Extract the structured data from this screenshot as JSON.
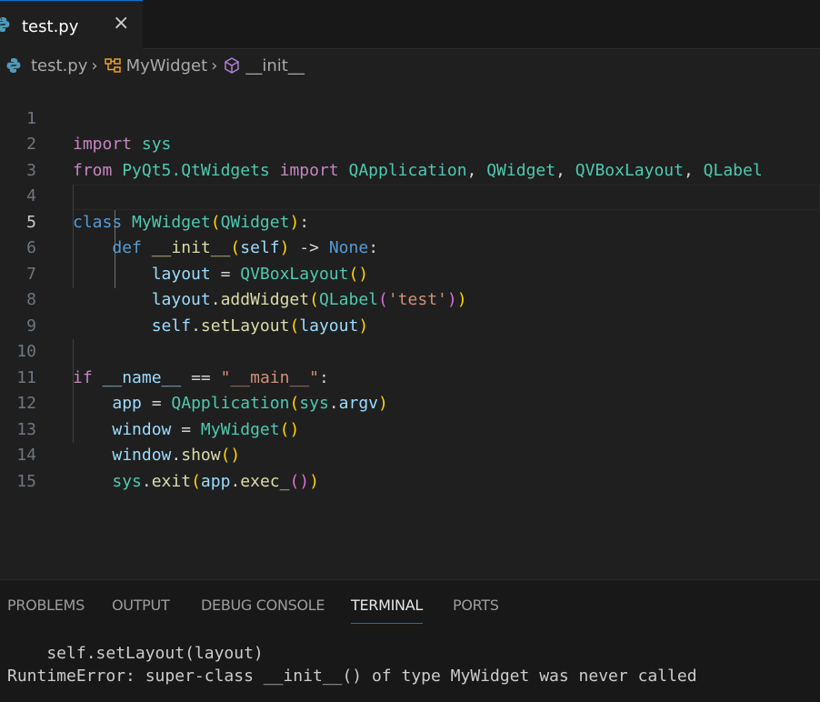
{
  "tab": {
    "label": "test.py",
    "close": "×"
  },
  "breadcrumb": {
    "file": "test.py",
    "class": "MyWidget",
    "method": "__init__",
    "sep": "›"
  },
  "lines": [
    "1",
    "2",
    "3",
    "4",
    "5",
    "6",
    "7",
    "8",
    "9",
    "10",
    "11",
    "12",
    "13",
    "14",
    "15"
  ],
  "code": {
    "l1": [
      "import",
      " ",
      "sys"
    ],
    "l2": [
      "from",
      " ",
      "PyQt5.QtWidgets",
      " ",
      "import",
      " ",
      "QApplication",
      ", ",
      "QWidget",
      ", ",
      "QVBoxLayout",
      ", ",
      "QLabel"
    ],
    "l4": [
      "class",
      " ",
      "MyWidget",
      "(",
      "QWidget",
      "):"
    ],
    "l5": [
      "    ",
      "def",
      " ",
      "__init__",
      "(",
      "self",
      ")",
      " -> ",
      "None",
      ":"
    ],
    "l6": [
      "        ",
      "layout",
      " = ",
      "QVBoxLayout",
      "()"
    ],
    "l7": [
      "        ",
      "layout",
      ".",
      "addWidget",
      "(",
      "QLabel",
      "(",
      "'test'",
      ")",
      ")"
    ],
    "l8": [
      "        ",
      "self",
      ".",
      "setLayout",
      "(",
      "layout",
      ")"
    ],
    "l10": [
      "if",
      " ",
      "__name__",
      " == ",
      "\"__main__\"",
      ":"
    ],
    "l11": [
      "    ",
      "app",
      " = ",
      "QApplication",
      "(",
      "sys",
      ".",
      "argv",
      ")"
    ],
    "l12": [
      "    ",
      "window",
      " = ",
      "MyWidget",
      "()"
    ],
    "l13": [
      "    ",
      "window",
      ".",
      "show",
      "()"
    ],
    "l14": [
      "    ",
      "sys",
      ".",
      "exit",
      "(",
      "app",
      ".",
      "exec_",
      "()",
      ")"
    ]
  },
  "panel": {
    "tabs": [
      "PROBLEMS",
      "OUTPUT",
      "DEBUG CONSOLE",
      "TERMINAL",
      "PORTS"
    ],
    "active_tab": "TERMINAL",
    "terminal": [
      "    self.setLayout(layout)",
      "RuntimeError: super-class __init__() of type MyWidget was never called"
    ]
  },
  "colors": {
    "accent": "#0078d4",
    "keyword": "#c586c0",
    "class": "#4ec9b0",
    "function": "#dcdcaa",
    "variable": "#9cdcfe",
    "string": "#ce9178"
  }
}
